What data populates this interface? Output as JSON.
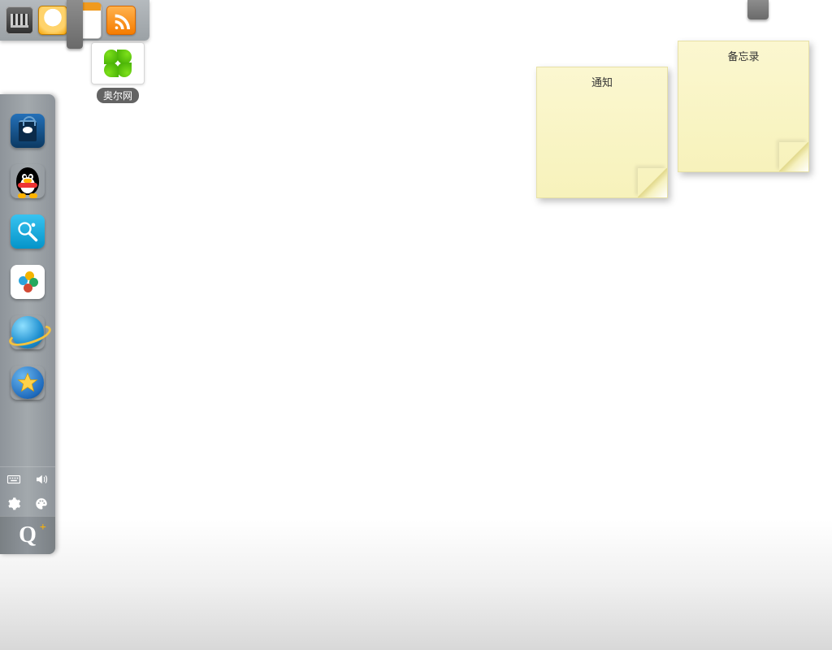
{
  "top_toolbar": {
    "items": [
      "media-icon",
      "clock-icon",
      "calendar-icon",
      "rss-icon"
    ]
  },
  "desktop_icon": {
    "label": "奥尔网"
  },
  "stickies": [
    {
      "title": "通知"
    },
    {
      "title": "备忘录"
    }
  ],
  "dock": {
    "apps": [
      "app-store",
      "qq-penguin",
      "search-app",
      "multi-app",
      "browser-globe",
      "qzone-star"
    ],
    "tray": [
      "keyboard-icon",
      "volume-icon",
      "settings-icon",
      "palette-icon"
    ],
    "launcher": "Q"
  }
}
